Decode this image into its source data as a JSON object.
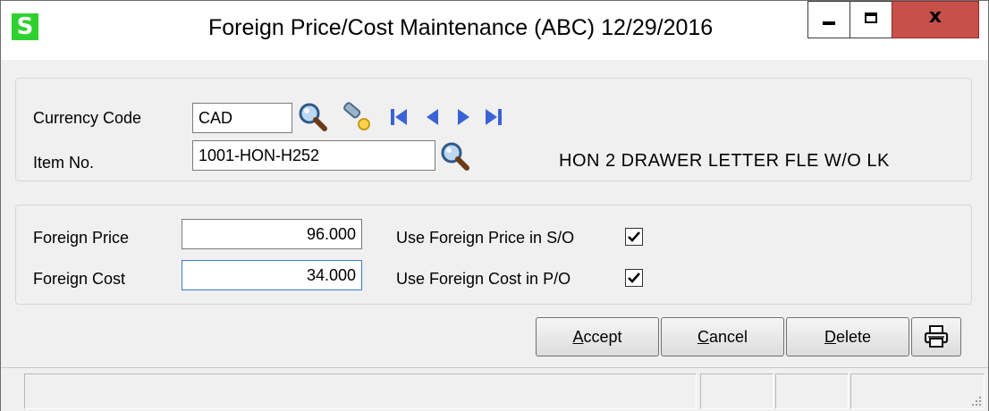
{
  "window": {
    "title": "Foreign Price/Cost Maintenance (ABC) 12/29/2016",
    "app_badge": "S",
    "close_glyph": "x"
  },
  "header_group": {
    "currency_code": {
      "label": "Currency Code",
      "value": "CAD"
    },
    "item_no": {
      "label": "Item No.",
      "value": "1001-HON-H252"
    },
    "item_description": "HON 2 DRAWER LETTER FLE W/O LK"
  },
  "pricing_group": {
    "foreign_price": {
      "label": "Foreign Price",
      "value": "96.000"
    },
    "foreign_cost": {
      "label": "Foreign Cost",
      "value": "34.000"
    },
    "use_price_so": {
      "label": "Use Foreign Price in S/O",
      "checked": true
    },
    "use_cost_po": {
      "label": "Use Foreign Cost in P/O",
      "checked": true
    }
  },
  "buttons": {
    "accept": {
      "mnemonic": "A",
      "rest": "ccept"
    },
    "cancel": {
      "mnemonic": "C",
      "rest": "ancel"
    },
    "delete": {
      "mnemonic": "D",
      "rest": "elete"
    }
  },
  "colors": {
    "app_badge": "#2fd12f",
    "close_button": "#c7504b",
    "nav_arrows": "#3a63d6",
    "focus_border": "#3d7bd0"
  }
}
